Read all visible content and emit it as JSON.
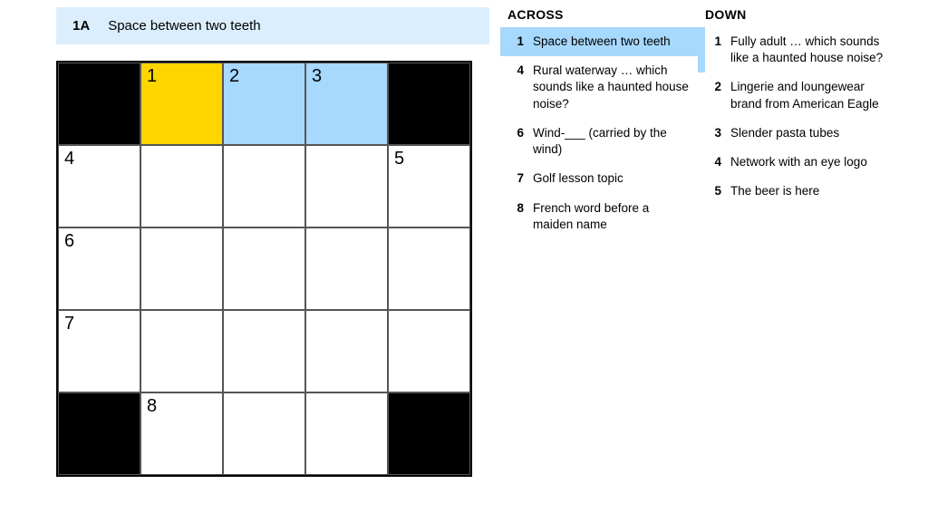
{
  "current_clue": {
    "label": "1A",
    "text": "Space between two teeth"
  },
  "grid": {
    "size": 5,
    "cells": [
      [
        {
          "black": true
        },
        {
          "num": "1",
          "state": "active"
        },
        {
          "num": "2",
          "state": "highlighted"
        },
        {
          "num": "3",
          "state": "highlighted"
        },
        {
          "black": true
        }
      ],
      [
        {
          "num": "4"
        },
        {},
        {},
        {},
        {
          "num": "5"
        }
      ],
      [
        {
          "num": "6"
        },
        {},
        {},
        {},
        {}
      ],
      [
        {
          "num": "7"
        },
        {},
        {},
        {},
        {}
      ],
      [
        {
          "black": true
        },
        {
          "num": "8"
        },
        {},
        {},
        {
          "black": true
        }
      ]
    ]
  },
  "clues": {
    "across": {
      "heading": "ACROSS",
      "items": [
        {
          "num": "1",
          "text": "Space between two teeth",
          "selected": true
        },
        {
          "num": "4",
          "text": "Rural waterway … which sounds like a haunted house noise?"
        },
        {
          "num": "6",
          "text": "Wind-___ (carried by the wind)"
        },
        {
          "num": "7",
          "text": "Golf lesson topic"
        },
        {
          "num": "8",
          "text": "French word before a maiden name"
        }
      ]
    },
    "down": {
      "heading": "DOWN",
      "items": [
        {
          "num": "1",
          "text": "Fully adult … which sounds like a haunted house noise?",
          "cross": true
        },
        {
          "num": "2",
          "text": "Lingerie and loungewear brand from American Eagle"
        },
        {
          "num": "3",
          "text": "Slender pasta tubes"
        },
        {
          "num": "4",
          "text": "Network with an eye logo"
        },
        {
          "num": "5",
          "text": "The beer is here"
        }
      ]
    }
  }
}
